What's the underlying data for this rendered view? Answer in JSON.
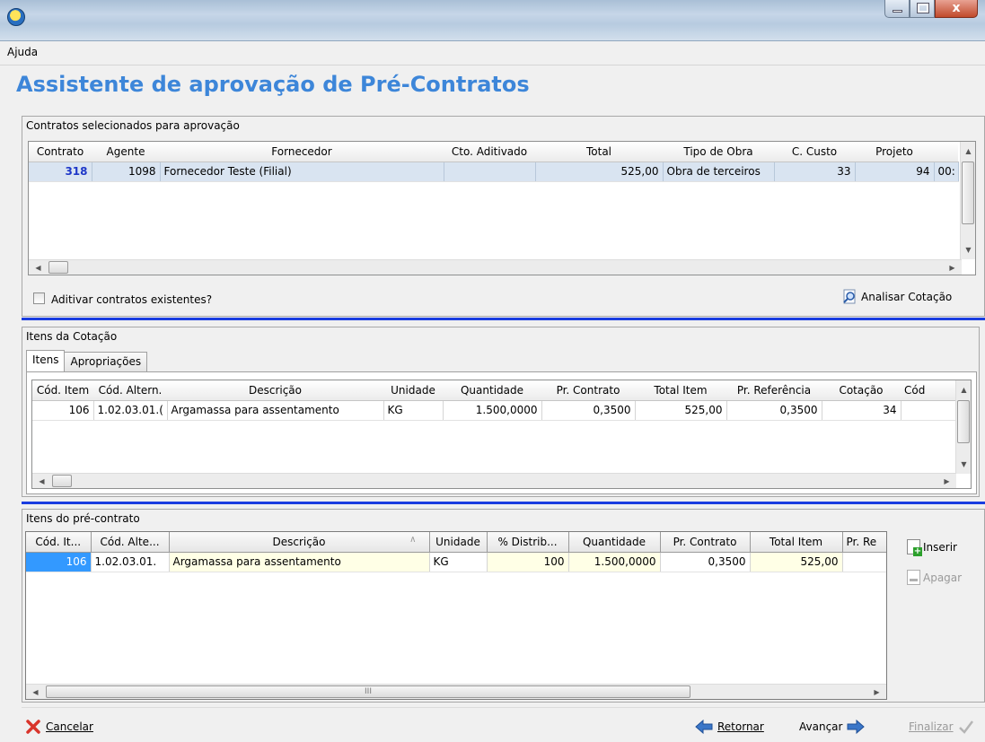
{
  "window": {
    "app_icon": "app-logo-icon",
    "buttons": [
      "minimize-icon",
      "maximize-icon",
      "close-icon"
    ],
    "close_glyph": "x"
  },
  "menu": {
    "items": [
      "Ajuda"
    ]
  },
  "title": "Assistente de aprovação de Pré-Contratos",
  "contracts": {
    "caption": "Contratos selecionados para aprovação",
    "columns": [
      "Contrato",
      "Agente",
      "Fornecedor",
      "Cto. Aditivado",
      "Total",
      "Tipo de Obra",
      "C. Custo",
      "Projeto"
    ],
    "rows": [
      {
        "contrato": "318",
        "agente": "1098",
        "fornecedor": "Fornecedor Teste (Filial)",
        "cto_aditivado": "",
        "total": "525,00",
        "tipo_obra": "Obra de terceiros",
        "c_custo": "33",
        "projeto": "94",
        "extra": "00:"
      }
    ],
    "checkbox_label": "Aditivar contratos existentes?",
    "analyze_button": "Analisar Cotação"
  },
  "quote_items": {
    "caption": "Itens da Cotação",
    "tabs": [
      "Itens",
      "Apropriações"
    ],
    "columns": [
      "Cód. Item",
      "Cód. Altern.",
      "Descrição",
      "Unidade",
      "Quantidade",
      "Pr. Contrato",
      "Total Item",
      "Pr. Referência",
      "Cotação",
      "Cód"
    ],
    "rows": [
      {
        "cod_item": "106",
        "cod_altern": "1.02.03.01.(",
        "descricao": "Argamassa para assentamento",
        "unidade": "KG",
        "quantidade": "1.500,0000",
        "pr_contrato": "0,3500",
        "total_item": "525,00",
        "pr_referencia": "0,3500",
        "cotacao": "34"
      }
    ]
  },
  "precontract_items": {
    "caption": "Itens do pré-contrato",
    "columns": [
      "Cód. It...",
      "Cód. Alte...",
      "Descrição",
      "Unidade",
      "% Distrib...",
      "Quantidade",
      "Pr. Contrato",
      "Total Item",
      "Pr. Re"
    ],
    "sort_glyph": "∧",
    "rows": [
      {
        "cod_item": "106",
        "cod_altern": "1.02.03.01.",
        "descricao": "Argamassa para assentamento",
        "unidade": "KG",
        "distrib": "100",
        "quantidade": "1.500,0000",
        "pr_contrato": "0,3500",
        "total_item": "525,00",
        "pr_ref": ""
      }
    ],
    "scroll_grip": "III",
    "insert_button": "Inserir",
    "delete_button": "Apagar"
  },
  "footer": {
    "cancel": "Cancelar",
    "back": "Retornar",
    "next": "Avançar",
    "finish": "Finalizar"
  },
  "colors": {
    "title": "#3d86d9",
    "separator": "#1a3de0",
    "selected_row": "#d9e4f1",
    "focus_cell": "#3399ff",
    "editable_cell": "#ffffe6"
  }
}
